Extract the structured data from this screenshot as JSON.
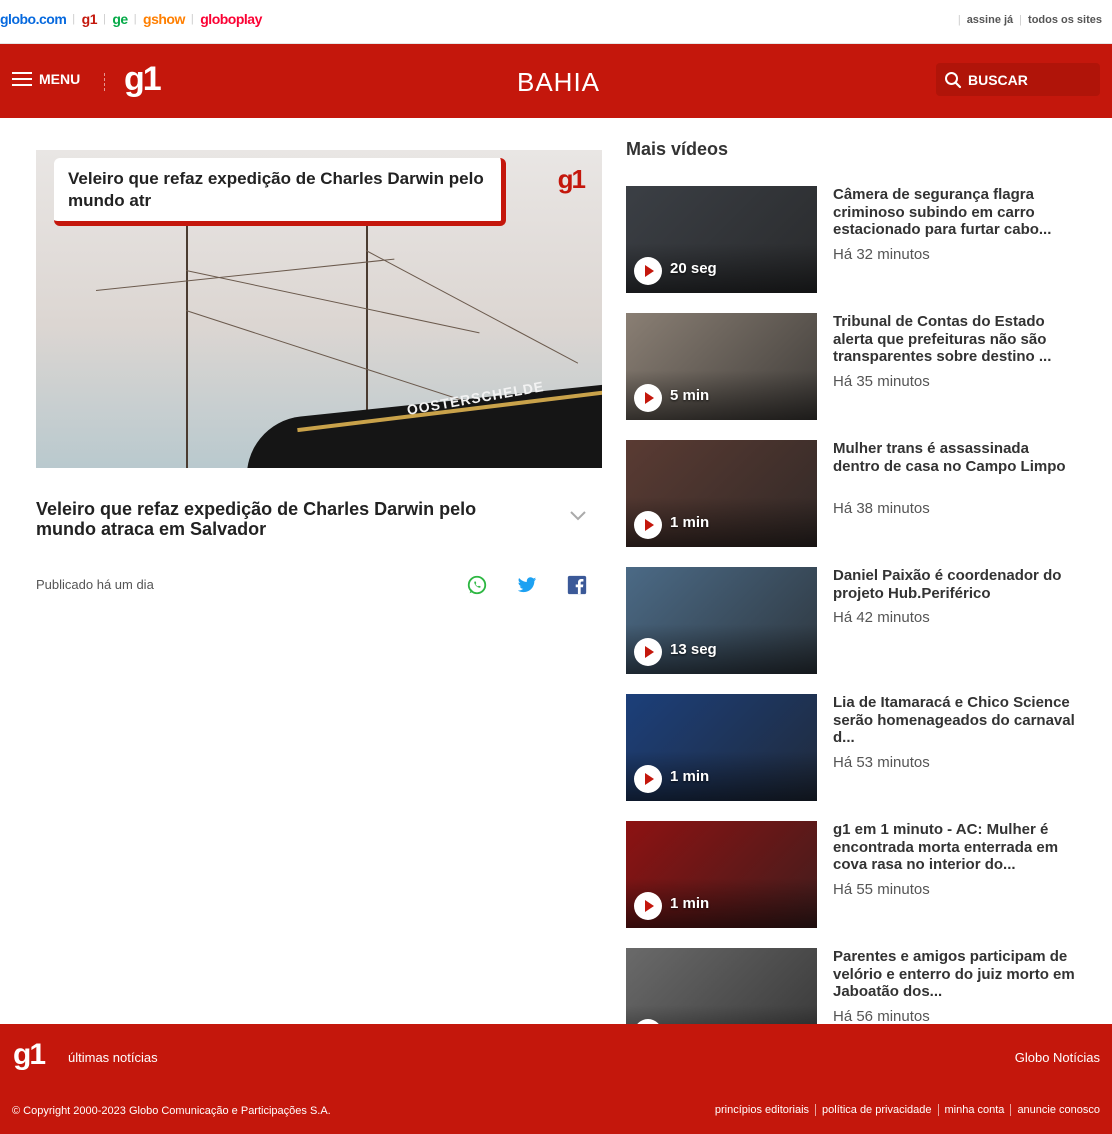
{
  "globo_bar": {
    "brands": [
      "globo.com",
      "g1",
      "ge",
      "gshow",
      "globoplay"
    ],
    "subscribe": "assine já",
    "all_sites": "todos os sites"
  },
  "header": {
    "menu_label": "MENU",
    "logo": "g1",
    "region": "BAHIA",
    "search_placeholder": "BUSCAR"
  },
  "video": {
    "overlay_text": "Veleiro que refaz expedição  de Charles Darwin pelo mundo atr",
    "watermark": "g1",
    "ship_name": "OOSTERSCHELDE",
    "title": "Veleiro que refaz expedição de Charles Darwin pelo mundo atraca em Salvador",
    "published": "Publicado há um dia"
  },
  "sidebar": {
    "title": "Mais vídeos",
    "items": [
      {
        "title": "Câmera de segurança flagra criminoso subindo em carro estacionado para furtar cabo...",
        "time": "Há 32 minutos",
        "duration": "20 seg",
        "color": "#3b3f45"
      },
      {
        "title": "Tribunal de Contas do Estado alerta que prefeituras não são transparentes sobre destino ...",
        "time": "Há 35 minutos",
        "duration": "5 min",
        "color": "#8a7f74"
      },
      {
        "title": "Mulher trans é assassinada dentro de casa no Campo Limpo",
        "time": "Há 38 minutos",
        "duration": "1 min",
        "color": "#5a3b33"
      },
      {
        "title": "Daniel Paixão é coordenador do projeto Hub.Periférico",
        "time": "Há 42 minutos",
        "duration": "13 seg",
        "color": "#4b6a86"
      },
      {
        "title": "Lia de Itamaracá e Chico Science serão homenageados do carnaval d...",
        "time": "Há 53 minutos",
        "duration": "1 min",
        "color": "#1c3f7a"
      },
      {
        "title": "g1 em 1 minuto - AC: Mulher é encontrada morta enterrada em cova rasa no interior do...",
        "time": "Há 55 minutos",
        "duration": "1 min",
        "color": "#8d1212"
      },
      {
        "title": "Parentes e amigos participam de velório e enterro do juiz morto em Jaboatão dos...",
        "time": "Há 56 minutos",
        "duration": "",
        "color": "#6a6a6a"
      }
    ]
  },
  "footer": {
    "logo": "g1",
    "latest": "últimas notícias",
    "globo_noticias": "Globo Notícias",
    "copyright": "© Copyright 2000-2023 Globo Comunicação e Participações S.A.",
    "links": [
      "princípios editoriais",
      "política de privacidade",
      "minha conta",
      "anuncie conosco"
    ]
  }
}
